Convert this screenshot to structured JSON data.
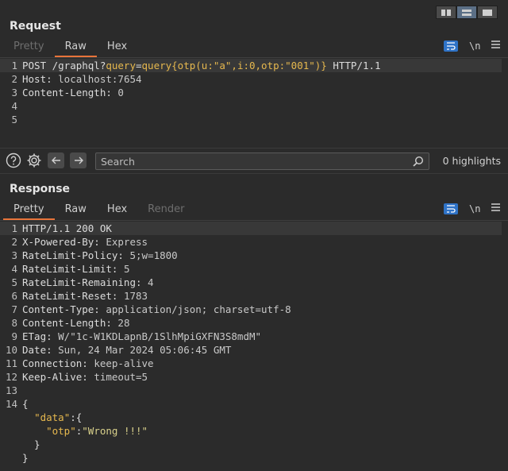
{
  "request": {
    "title": "Request",
    "tabs": [
      {
        "label": "Pretty",
        "state": "dim"
      },
      {
        "label": "Raw",
        "state": "active"
      },
      {
        "label": "Hex",
        "state": "normal"
      }
    ],
    "newline_toggle": "\\n",
    "lines": [
      {
        "num": "1",
        "parts": [
          {
            "t": "POST /graphql?",
            "c": "k"
          },
          {
            "t": "query",
            "c": "q"
          },
          {
            "t": "=",
            "c": "k"
          },
          {
            "t": "query{otp(u:\"a\",i:0,otp:\"001\")}",
            "c": "q"
          },
          {
            "t": " HTTP/1.1",
            "c": "k"
          }
        ]
      },
      {
        "num": "2",
        "parts": [
          {
            "t": "Host: ",
            "c": "k"
          },
          {
            "t": "localhost:7654",
            "c": "v"
          }
        ]
      },
      {
        "num": "3",
        "parts": [
          {
            "t": "Content-Length: ",
            "c": "k"
          },
          {
            "t": "0",
            "c": "v"
          }
        ]
      },
      {
        "num": "4",
        "parts": []
      },
      {
        "num": "5",
        "parts": []
      }
    ]
  },
  "search": {
    "placeholder": "Search",
    "value": "",
    "highlights": "0 highlights"
  },
  "response": {
    "title": "Response",
    "tabs": [
      {
        "label": "Pretty",
        "state": "active"
      },
      {
        "label": "Raw",
        "state": "normal"
      },
      {
        "label": "Hex",
        "state": "normal"
      },
      {
        "label": "Render",
        "state": "dim"
      }
    ],
    "newline_toggle": "\\n",
    "lines": [
      {
        "num": "1",
        "parts": [
          {
            "t": "HTTP/1.1 200 OK",
            "c": "k"
          }
        ]
      },
      {
        "num": "2",
        "parts": [
          {
            "t": "X-Powered-By: ",
            "c": "k"
          },
          {
            "t": "Express",
            "c": "v"
          }
        ]
      },
      {
        "num": "3",
        "parts": [
          {
            "t": "RateLimit-Policy: ",
            "c": "k"
          },
          {
            "t": "5;w=1800",
            "c": "v"
          }
        ]
      },
      {
        "num": "4",
        "parts": [
          {
            "t": "RateLimit-Limit: ",
            "c": "k"
          },
          {
            "t": "5",
            "c": "v"
          }
        ]
      },
      {
        "num": "5",
        "parts": [
          {
            "t": "RateLimit-Remaining: ",
            "c": "k"
          },
          {
            "t": "4",
            "c": "v"
          }
        ]
      },
      {
        "num": "6",
        "parts": [
          {
            "t": "RateLimit-Reset: ",
            "c": "k"
          },
          {
            "t": "1783",
            "c": "v"
          }
        ]
      },
      {
        "num": "7",
        "parts": [
          {
            "t": "Content-Type: ",
            "c": "k"
          },
          {
            "t": "application/json; charset=utf-8",
            "c": "v"
          }
        ]
      },
      {
        "num": "8",
        "parts": [
          {
            "t": "Content-Length: ",
            "c": "k"
          },
          {
            "t": "28",
            "c": "v"
          }
        ]
      },
      {
        "num": "9",
        "parts": [
          {
            "t": "ETag: ",
            "c": "k"
          },
          {
            "t": "W/\"1c-W1KDLapnB/1SlhMpiGXFN3S8mdM\"",
            "c": "v"
          }
        ]
      },
      {
        "num": "10",
        "parts": [
          {
            "t": "Date: ",
            "c": "k"
          },
          {
            "t": "Sun, 24 Mar 2024 05:06:45 GMT",
            "c": "v"
          }
        ]
      },
      {
        "num": "11",
        "parts": [
          {
            "t": "Connection: ",
            "c": "k"
          },
          {
            "t": "keep-alive",
            "c": "v"
          }
        ]
      },
      {
        "num": "12",
        "parts": [
          {
            "t": "Keep-Alive: ",
            "c": "k"
          },
          {
            "t": "timeout=5",
            "c": "v"
          }
        ]
      },
      {
        "num": "13",
        "parts": []
      },
      {
        "num": "14",
        "parts": [
          {
            "t": "{",
            "c": "k"
          }
        ]
      },
      {
        "num": "",
        "parts": [
          {
            "t": "  ",
            "c": "k"
          },
          {
            "t": "\"data\"",
            "c": "q"
          },
          {
            "t": ":{",
            "c": "k"
          }
        ]
      },
      {
        "num": "",
        "parts": [
          {
            "t": "    ",
            "c": "k"
          },
          {
            "t": "\"otp\"",
            "c": "q"
          },
          {
            "t": ":",
            "c": "k"
          },
          {
            "t": "\"Wrong !!!\"",
            "c": "s"
          }
        ]
      },
      {
        "num": "",
        "parts": [
          {
            "t": "  }",
            "c": "k"
          }
        ]
      },
      {
        "num": "",
        "parts": [
          {
            "t": "}",
            "c": "k"
          }
        ]
      }
    ]
  },
  "colors": {
    "accent_tab": "#e8743a",
    "wrap_button": "#2f73c7",
    "json_key": "#e6b84e",
    "json_string": "#d9d18b"
  }
}
